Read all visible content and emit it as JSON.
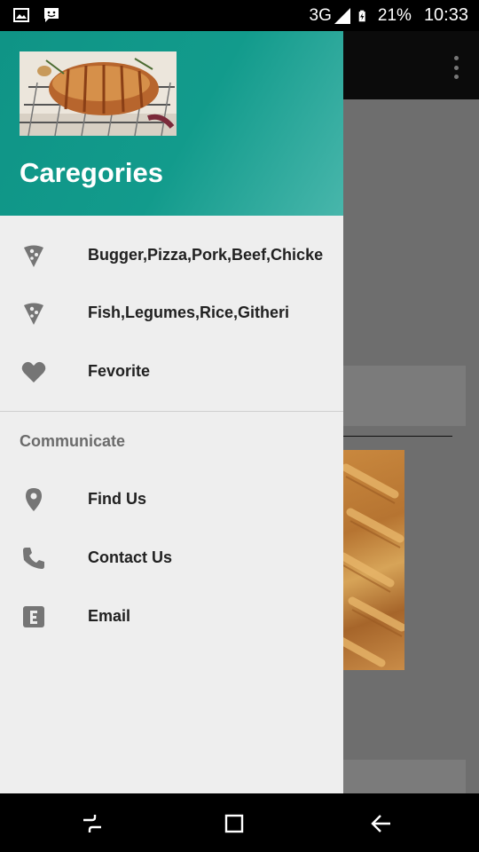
{
  "status_bar": {
    "network": "3G",
    "battery": "21%",
    "time": "10:33",
    "icons": [
      "image-icon",
      "message-icon",
      "signal-icon",
      "battery-icon"
    ]
  },
  "drawer": {
    "header_title": "Caregories",
    "header_image": "roast-meat-image",
    "items": [
      {
        "label": "Bugger,Pizza,Pork,Beef,Chicke",
        "icon": "pizza-icon"
      },
      {
        "label": "Fish,Legumes,Rice,Githeri",
        "icon": "pizza-icon"
      },
      {
        "label": "Fevorite",
        "icon": "heart-icon"
      }
    ],
    "section_title": "Communicate",
    "communicate_items": [
      {
        "label": "Find Us",
        "icon": "location-pin-icon"
      },
      {
        "label": "Contact Us",
        "icon": "phone-icon"
      },
      {
        "label": "Email",
        "icon": "email-icon"
      }
    ]
  },
  "colors": {
    "header_accent": "#129b8c",
    "drawer_bg": "#eeeeee",
    "icon_grey": "#757575"
  },
  "nav_bar": {
    "buttons": [
      "recent-apps-icon",
      "home-icon",
      "back-icon"
    ]
  }
}
